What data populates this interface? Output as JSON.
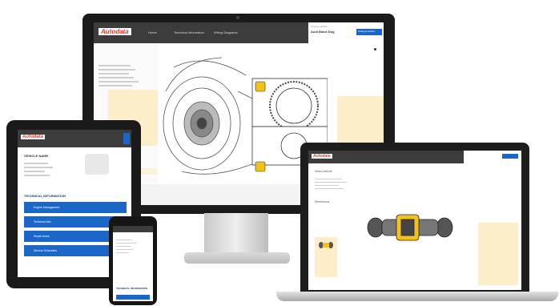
{
  "brand": {
    "logo_text": "Autodata",
    "accent": "#c8181e",
    "primary_blue": "#1a67c8",
    "bar_dark": "#3c3c3c",
    "highlight": "#fbeec8"
  },
  "desktop": {
    "tabs": [
      "Home",
      "Technical Information",
      "Wiring Diagrams"
    ],
    "vehicle_label": "Choose vehicle",
    "vehicle_name": "Audi Black Dog",
    "action_button": "Change Vehicle",
    "more_icon": "more-icon"
  },
  "tablet": {
    "vehicle_title": "VEHICLE NAME",
    "section_title": "TECHNICAL INFORMATION",
    "menu_items": [
      "Engine Management",
      "Technical Info",
      "Repair times",
      "Service Schedules"
    ]
  },
  "phone": {
    "section_title": "TECHNICAL INFORMATION"
  },
  "laptop": {
    "panel_title": "Select vehicle",
    "section": "Dimensions"
  }
}
